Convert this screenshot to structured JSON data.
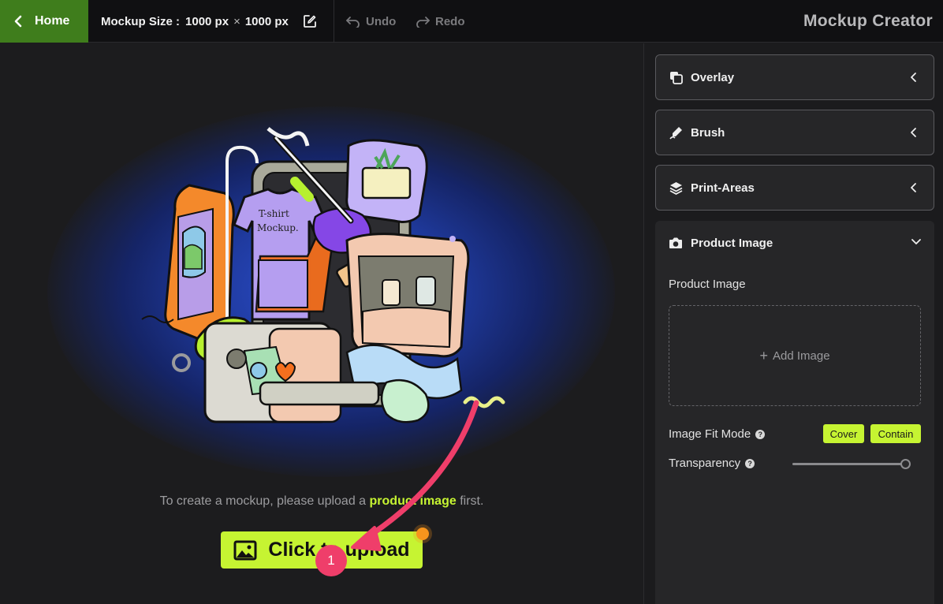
{
  "topbar": {
    "home_label": "Home",
    "size_label": "Mockup Size :",
    "width": "1000 px",
    "times": "×",
    "height": "1000 px",
    "undo_label": "Undo",
    "redo_label": "Redo",
    "app_title": "Mockup Creator"
  },
  "canvas": {
    "hint_prefix": "To create a mockup, please upload a",
    "hint_highlight": "product image",
    "hint_suffix": "first.",
    "upload_label": "Click to upload",
    "step_number": "1"
  },
  "panel": {
    "sections": [
      {
        "label": "Overlay",
        "icon": "layers-copy-icon"
      },
      {
        "label": "Brush",
        "icon": "brush-icon"
      },
      {
        "label": "Print-Areas",
        "icon": "stack-icon"
      }
    ],
    "product": {
      "title": "Product Image",
      "field_label": "Product Image",
      "add_image": "Add Image",
      "fit_label": "Image Fit Mode",
      "fit_options": [
        "Cover",
        "Contain"
      ],
      "transparency_label": "Transparency",
      "transparency_value": 1.0
    }
  },
  "colors": {
    "accent": "#c6f432",
    "home_bg": "#3f7d1c",
    "arrow": "#ef3e6a",
    "dot": "#f7941d"
  }
}
